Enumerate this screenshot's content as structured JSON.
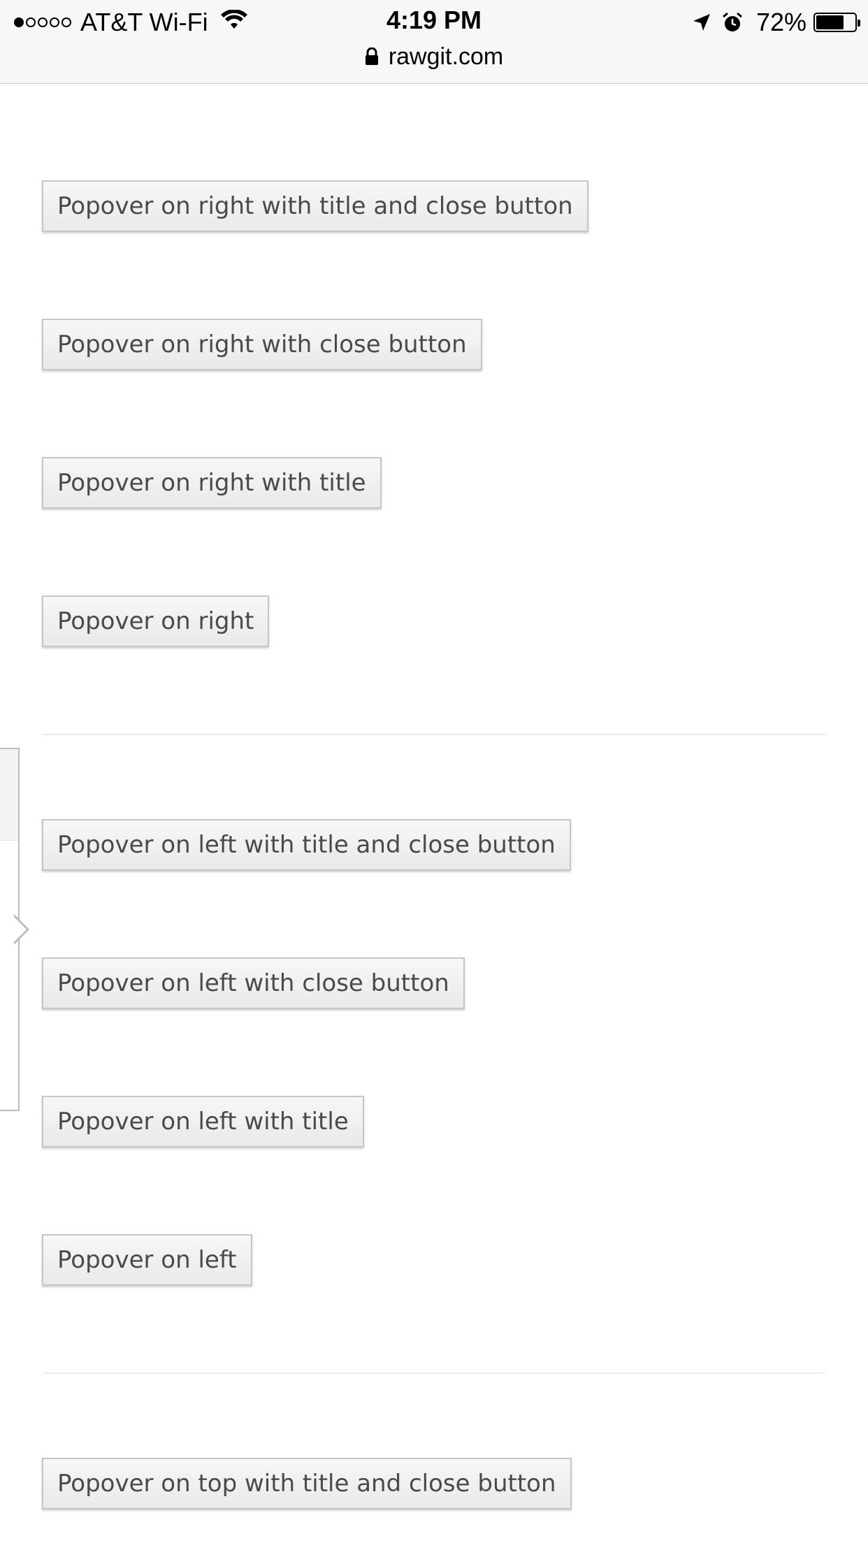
{
  "status_bar": {
    "carrier": "AT&T Wi-Fi",
    "time": "4:19 PM",
    "battery_percent": "72%",
    "battery_level": 0.72,
    "signal_filled": 1,
    "signal_total": 5
  },
  "browser": {
    "url": "rawgit.com"
  },
  "buttons": {
    "right_title_close": "Popover on right with title and close button",
    "right_close": "Popover on right with close button",
    "right_title": "Popover on right with title",
    "right": "Popover on right",
    "left_title_close": "Popover on left with title and close button",
    "left_close": "Popover on left with close button",
    "left_title": "Popover on left with title",
    "left": "Popover on left",
    "top_title_close": "Popover on top with title and close button"
  },
  "colors": {
    "button_text": "#4a4a4a",
    "button_border": "#c6c6c6",
    "status_bar_bg": "#f7f7f7"
  }
}
